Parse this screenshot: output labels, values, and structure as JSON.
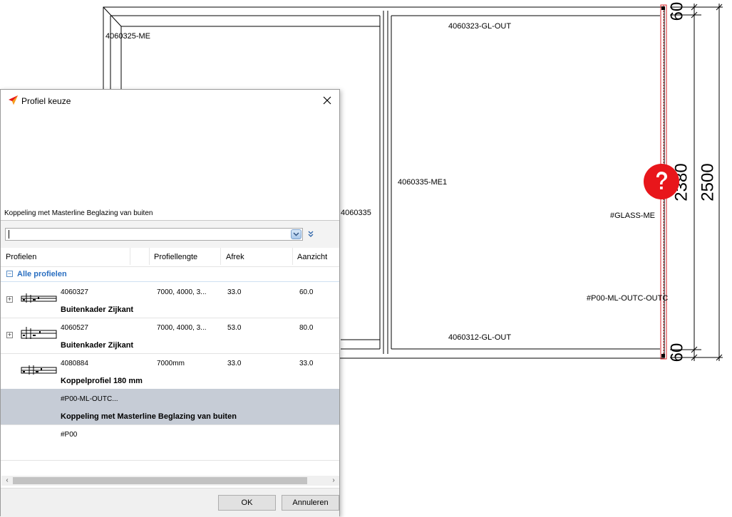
{
  "drawing": {
    "labels": {
      "frame_top_left": "4060325-ME",
      "frame_top_right": "4060323-GL-OUT",
      "mullion": "4060335-ME1",
      "mullion_left": "4060335",
      "glass": "#GLASS-ME",
      "coupling": "#P00-ML-OUTC-OUTC",
      "frame_bottom": "4060312-GL-OUT"
    },
    "dimensions": {
      "top": "60",
      "middle": "2380",
      "bottom": "60",
      "overall": "2500"
    },
    "warning_symbol": "?",
    "warning_icon": "question-mark-icon",
    "warning_color": "#e8161b"
  },
  "dialog": {
    "title": "Profiel keuze",
    "preview_caption": "Koppeling met Masterline Beglazing van buiten",
    "search": {
      "value": "",
      "placeholder": ""
    },
    "columns": [
      "Profielen",
      "Profiellengte",
      "Afrek",
      "Aanzicht"
    ],
    "group_label": "Alle profielen",
    "rows": [
      {
        "code": "4060327",
        "name": "Buitenkader Zijkant",
        "length": "7000,  4000,  3...",
        "afrek": "33.0",
        "aanzicht": "60.0",
        "expandable": true,
        "selected": false
      },
      {
        "code": "4060527",
        "name": "Buitenkader Zijkant",
        "length": "7000,  4000,  3...",
        "afrek": "53.0",
        "aanzicht": "80.0",
        "expandable": true,
        "selected": false
      },
      {
        "code": "4080884",
        "name": "Koppelprofiel 180 mm",
        "length": "7000mm",
        "afrek": "33.0",
        "aanzicht": "33.0",
        "expandable": false,
        "selected": false
      },
      {
        "code": "#P00-ML-OUTC...",
        "name": "Koppeling met Masterline Beglazing van buiten",
        "length": "",
        "afrek": "",
        "aanzicht": "",
        "expandable": false,
        "selected": true
      },
      {
        "code": "#P00",
        "name": "",
        "length": "",
        "afrek": "",
        "aanzicht": "",
        "expandable": false,
        "selected": false
      }
    ],
    "ok_label": "OK",
    "cancel_label": "Annuleren",
    "accent_color": "#2a6fc1",
    "selected_row_color": "#c6ccd6"
  }
}
